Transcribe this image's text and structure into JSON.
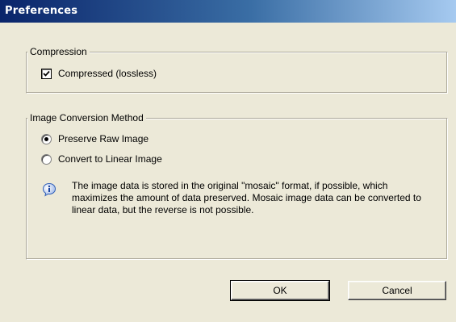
{
  "window": {
    "title": "Preferences"
  },
  "compression": {
    "legend": "Compression",
    "checkbox_label": "Compressed (lossless)",
    "checked": true
  },
  "conversion": {
    "legend": "Image Conversion Method",
    "options": [
      {
        "label": "Preserve Raw Image",
        "selected": true
      },
      {
        "label": "Convert to Linear Image",
        "selected": false
      }
    ],
    "info_icon": "info-icon",
    "info_text": "The image data is stored in the original \"mosaic\" format, if possible, which maximizes the amount of data preserved.  Mosaic image data can be converted to linear data, but the reverse is not possible."
  },
  "buttons": {
    "ok_label": "OK",
    "cancel_label": "Cancel"
  },
  "colors": {
    "title_start": "#0a246a",
    "title_end": "#a6caf0",
    "dialog_bg": "#ece9d8"
  }
}
